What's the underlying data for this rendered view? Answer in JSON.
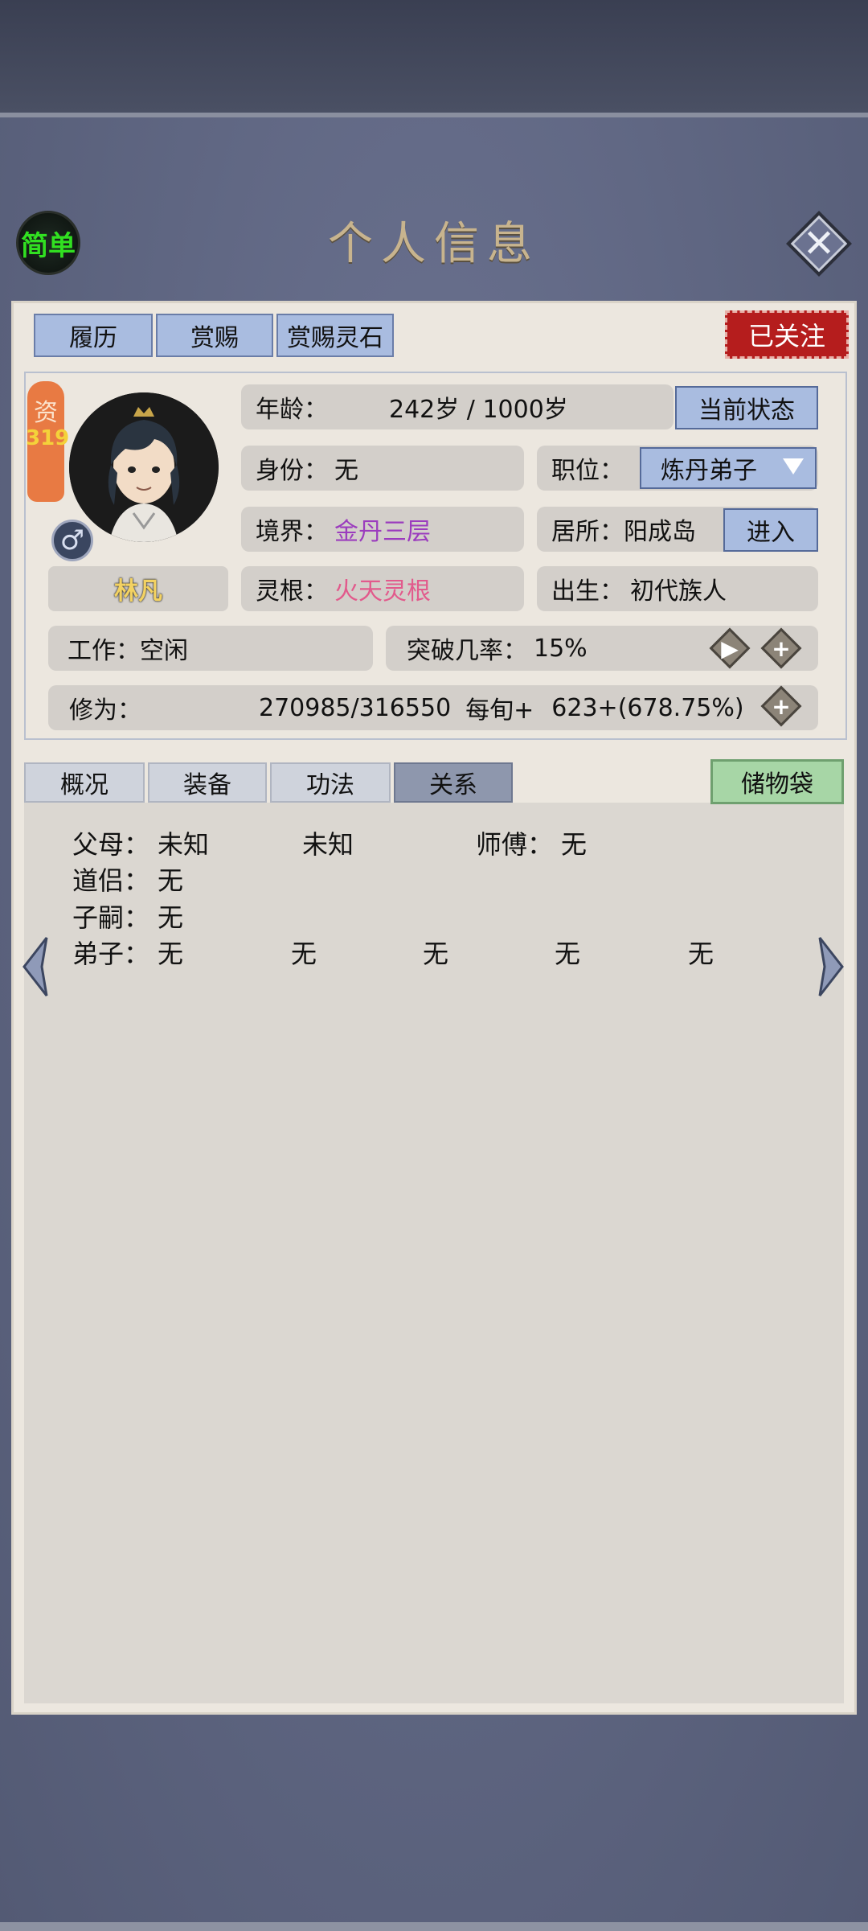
{
  "header": {
    "simple_label": "简单",
    "title": "个人信息",
    "close_icon": "close-icon"
  },
  "top_tabs": [
    "履历",
    "赏赐",
    "赏赐灵石"
  ],
  "follow_label": "已关注",
  "character": {
    "zi_label": "资",
    "zi_value": "319",
    "name": "林凡",
    "gender_symbol": "♂",
    "age_label": "年龄：",
    "age_value": "242岁 / 1000岁",
    "status_button": "当前状态",
    "identity_label": "身份：",
    "identity_value": "无",
    "position_label": "职位：",
    "position_value": "炼丹弟子",
    "realm_label": "境界：",
    "realm_value": "金丹三层",
    "residence_label": "居所：",
    "residence_value": "阳成岛",
    "enter_button": "进入",
    "root_label": "灵根：",
    "root_value": "火天灵根",
    "birth_label": "出生：",
    "birth_value": "初代族人",
    "work_label": "工作：",
    "work_value": "空闲",
    "breakthrough_label": "突破几率：",
    "breakthrough_value": "15%",
    "cultivation_label": "修为：",
    "cultivation_value": "270985/316550",
    "per_label": "每旬+",
    "per_value": "623+(678.75%)"
  },
  "sub_tabs": [
    "概况",
    "装备",
    "功法",
    "关系"
  ],
  "active_sub_tab": "关系",
  "bag_label": "储物袋",
  "relations": {
    "parents_label": "父母：",
    "parent1": "未知",
    "parent2": "未知",
    "master_label": "师傅：",
    "master_value": "无",
    "partner_label": "道侣：",
    "partner_value": "无",
    "children_label": "子嗣：",
    "children_value": "无",
    "disciples_label": "弟子：",
    "disciples": [
      "无",
      "无",
      "无",
      "无",
      "无"
    ]
  },
  "colors": {
    "accent_blue": "#a9bce0",
    "follow_red": "#b51d1d",
    "realm_purple": "#9b3cbe",
    "root_pink": "#e25a8c",
    "bag_green": "#a7d6a6"
  }
}
